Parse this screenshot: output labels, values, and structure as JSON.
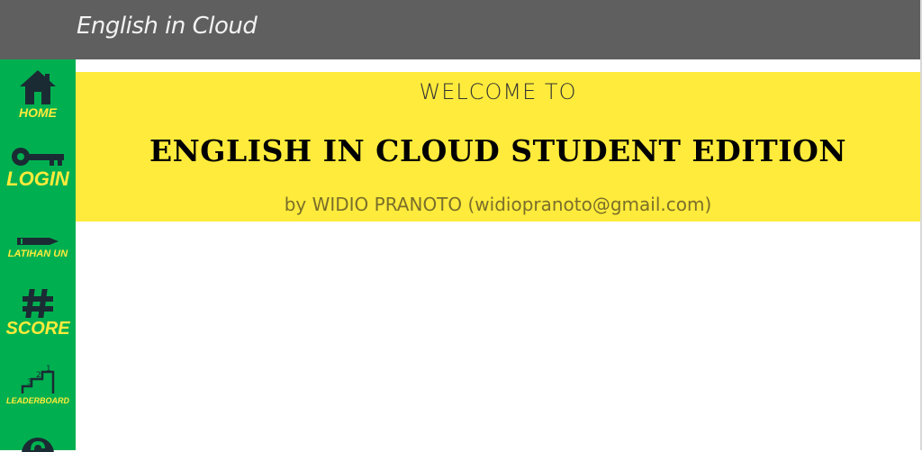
{
  "app": {
    "title": "English in Cloud"
  },
  "sidebar": {
    "items": [
      {
        "label": "HOME",
        "icon": "home-icon"
      },
      {
        "label": "LOGIN",
        "icon": "key-icon"
      },
      {
        "label": "LATIHAN UN",
        "icon": "pencil-icon"
      },
      {
        "label": "SCORE",
        "icon": "hash-icon"
      },
      {
        "label": "LEADERBOARD",
        "icon": "podium-icon"
      },
      {
        "label": "",
        "icon": "help-icon"
      }
    ]
  },
  "banner": {
    "welcome": "WELCOME TO",
    "headline": "ENGLISH IN CLOUD STUDENT EDITION",
    "byline": "by WIDIO PRANOTO (widiopranoto@gmail.com)"
  },
  "colors": {
    "titlebar": "#5f5f5f",
    "sidebar": "#00b050",
    "accent_yellow": "#ffeb3b",
    "icon_dark": "#1a2b33"
  }
}
